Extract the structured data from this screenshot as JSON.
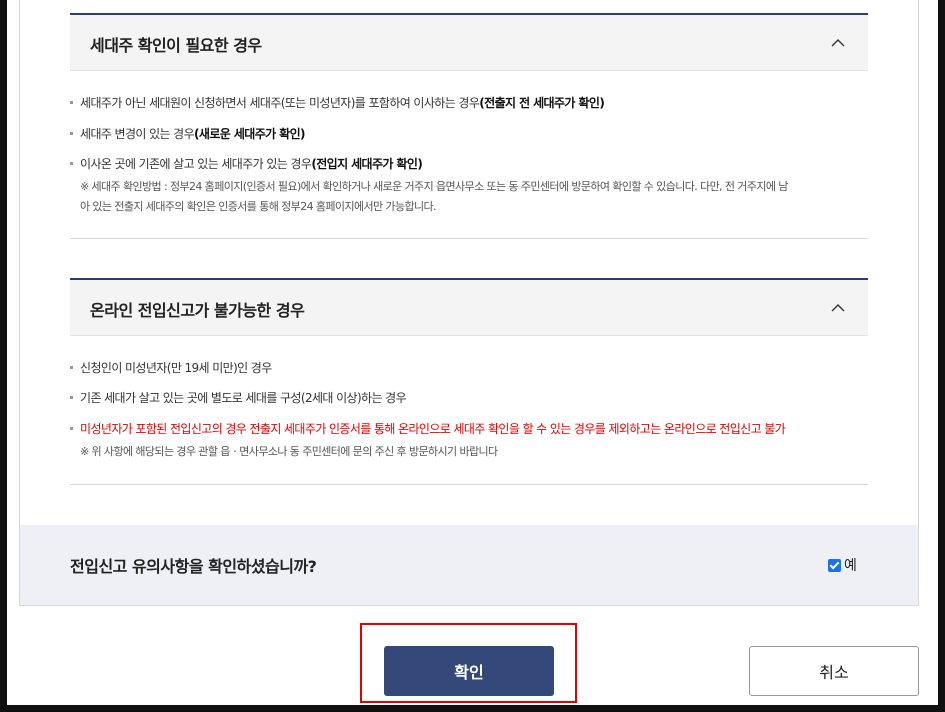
{
  "section1": {
    "title": "세대주 확인이 필요한 경우",
    "items": [
      {
        "text": "세대주가 아닌 세대원이 신청하면서 세대주(또는 미성년자)를 포함하여 이사하는 경우",
        "strong": "(전출지 전 세대주가 확인)"
      },
      {
        "text": "세대주 변경이 있는 경우",
        "strong": "(새로운 세대주가 확인)"
      },
      {
        "text": "이사온 곳에 기존에 살고 있는 세대주가 있는 경우",
        "strong": "(전입지 세대주가 확인)"
      }
    ],
    "note_line1": "※ 세대주 확인방법 : 정부24 홈페이지(인증서 필요)에서 확인하거나 새로운 거주지 읍면사무소 또는 동 주민센터에 방문하여 확인할 수 있습니다. 다만, 전 거주지에 남",
    "note_line2": "아 있는 전출지 세대주의 확인은 인증서를 통해 정부24 홈페이지에서만 가능합니다."
  },
  "section2": {
    "title": "온라인 전입신고가 불가능한 경우",
    "items": [
      {
        "text": "신청인이 미성년자(만 19세 미만)인 경우"
      },
      {
        "text": "기존 세대가 살고 있는 곳에 별도로 세대를 구성(2세대 이상)하는 경우"
      }
    ],
    "red_item": "미성년자가 포함된 전입신고의 경우 전출지 세대주가 인증서를 통해 온라인으로 세대주 확인을 할 수 있는 경우를 제외하고는 온라인으로 전입신고 불가",
    "note": "※ 위 사항에 해당되는 경우 관할 읍ㆍ면사무소나 동 주민센터에 문의 주신 후 방문하시기 바랍니다"
  },
  "confirm": {
    "question": "전입신고 유의사항을 확인하셨습니까?",
    "checkbox_label": "예",
    "checked": true
  },
  "buttons": {
    "ok_label": "확인",
    "cancel_label": "취소"
  },
  "colors": {
    "header_border": "#2e3f6e",
    "primary_button": "#34497a",
    "warning_text": "#e60000",
    "highlight": "#e00000"
  }
}
